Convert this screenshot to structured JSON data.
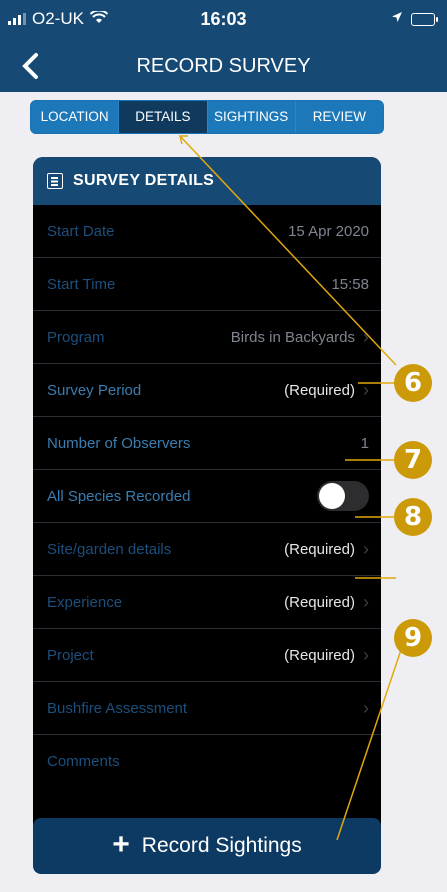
{
  "status": {
    "carrier": "O2-UK",
    "time": "16:03"
  },
  "header": {
    "title": "RECORD SURVEY"
  },
  "tabs": [
    {
      "label": "LOCATION",
      "active": false
    },
    {
      "label": "DETAILS",
      "active": true
    },
    {
      "label": "SIGHTINGS",
      "active": false
    },
    {
      "label": "REVIEW",
      "active": false
    }
  ],
  "card": {
    "title": "SURVEY DETAILS",
    "rows": [
      {
        "label": "Start Date",
        "value": "15 Apr 2020"
      },
      {
        "label": "Start Time",
        "value": "15:58"
      },
      {
        "label": "Program",
        "value": "Birds in Backyards"
      },
      {
        "label": "Survey Period",
        "value": "(Required)"
      },
      {
        "label": "Number of Observers",
        "value": "1"
      },
      {
        "label": "All Species Recorded",
        "toggle_on": false
      },
      {
        "label": "Site/garden details",
        "value": "(Required)"
      },
      {
        "label": "Experience",
        "value": "(Required)"
      },
      {
        "label": "Project",
        "value": "(Required)"
      },
      {
        "label": "Bushfire Assessment",
        "value": ""
      },
      {
        "label": "Comments",
        "value": ""
      }
    ]
  },
  "action": {
    "label": "Record Sightings"
  },
  "annotations": [
    {
      "number": "6"
    },
    {
      "number": "7"
    },
    {
      "number": "8"
    },
    {
      "number": "9"
    }
  ],
  "colors": {
    "brand": "#164a75",
    "tab_accent": "#1c78b9",
    "badge": "#cc9a08",
    "row_label": "#1c4f7d"
  }
}
